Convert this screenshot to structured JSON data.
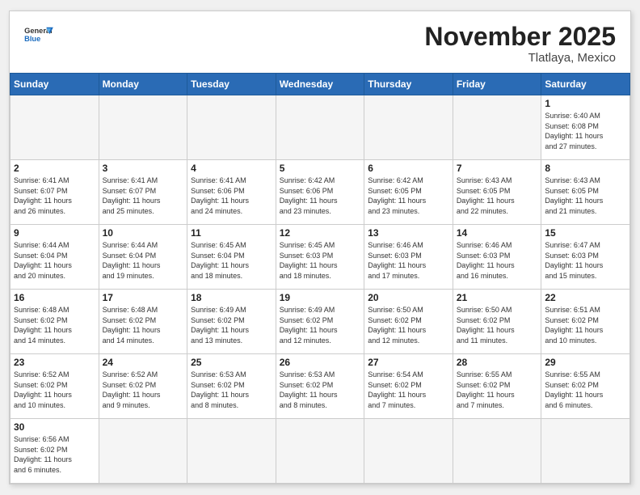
{
  "header": {
    "logo_general": "General",
    "logo_blue": "Blue",
    "month_title": "November 2025",
    "location": "Tlatlaya, Mexico"
  },
  "weekdays": [
    "Sunday",
    "Monday",
    "Tuesday",
    "Wednesday",
    "Thursday",
    "Friday",
    "Saturday"
  ],
  "weeks": [
    [
      {
        "day": "",
        "info": ""
      },
      {
        "day": "",
        "info": ""
      },
      {
        "day": "",
        "info": ""
      },
      {
        "day": "",
        "info": ""
      },
      {
        "day": "",
        "info": ""
      },
      {
        "day": "",
        "info": ""
      },
      {
        "day": "1",
        "info": "Sunrise: 6:40 AM\nSunset: 6:08 PM\nDaylight: 11 hours\nand 27 minutes."
      }
    ],
    [
      {
        "day": "2",
        "info": "Sunrise: 6:41 AM\nSunset: 6:07 PM\nDaylight: 11 hours\nand 26 minutes."
      },
      {
        "day": "3",
        "info": "Sunrise: 6:41 AM\nSunset: 6:07 PM\nDaylight: 11 hours\nand 25 minutes."
      },
      {
        "day": "4",
        "info": "Sunrise: 6:41 AM\nSunset: 6:06 PM\nDaylight: 11 hours\nand 24 minutes."
      },
      {
        "day": "5",
        "info": "Sunrise: 6:42 AM\nSunset: 6:06 PM\nDaylight: 11 hours\nand 23 minutes."
      },
      {
        "day": "6",
        "info": "Sunrise: 6:42 AM\nSunset: 6:05 PM\nDaylight: 11 hours\nand 23 minutes."
      },
      {
        "day": "7",
        "info": "Sunrise: 6:43 AM\nSunset: 6:05 PM\nDaylight: 11 hours\nand 22 minutes."
      },
      {
        "day": "8",
        "info": "Sunrise: 6:43 AM\nSunset: 6:05 PM\nDaylight: 11 hours\nand 21 minutes."
      }
    ],
    [
      {
        "day": "9",
        "info": "Sunrise: 6:44 AM\nSunset: 6:04 PM\nDaylight: 11 hours\nand 20 minutes."
      },
      {
        "day": "10",
        "info": "Sunrise: 6:44 AM\nSunset: 6:04 PM\nDaylight: 11 hours\nand 19 minutes."
      },
      {
        "day": "11",
        "info": "Sunrise: 6:45 AM\nSunset: 6:04 PM\nDaylight: 11 hours\nand 18 minutes."
      },
      {
        "day": "12",
        "info": "Sunrise: 6:45 AM\nSunset: 6:03 PM\nDaylight: 11 hours\nand 18 minutes."
      },
      {
        "day": "13",
        "info": "Sunrise: 6:46 AM\nSunset: 6:03 PM\nDaylight: 11 hours\nand 17 minutes."
      },
      {
        "day": "14",
        "info": "Sunrise: 6:46 AM\nSunset: 6:03 PM\nDaylight: 11 hours\nand 16 minutes."
      },
      {
        "day": "15",
        "info": "Sunrise: 6:47 AM\nSunset: 6:03 PM\nDaylight: 11 hours\nand 15 minutes."
      }
    ],
    [
      {
        "day": "16",
        "info": "Sunrise: 6:48 AM\nSunset: 6:02 PM\nDaylight: 11 hours\nand 14 minutes."
      },
      {
        "day": "17",
        "info": "Sunrise: 6:48 AM\nSunset: 6:02 PM\nDaylight: 11 hours\nand 14 minutes."
      },
      {
        "day": "18",
        "info": "Sunrise: 6:49 AM\nSunset: 6:02 PM\nDaylight: 11 hours\nand 13 minutes."
      },
      {
        "day": "19",
        "info": "Sunrise: 6:49 AM\nSunset: 6:02 PM\nDaylight: 11 hours\nand 12 minutes."
      },
      {
        "day": "20",
        "info": "Sunrise: 6:50 AM\nSunset: 6:02 PM\nDaylight: 11 hours\nand 12 minutes."
      },
      {
        "day": "21",
        "info": "Sunrise: 6:50 AM\nSunset: 6:02 PM\nDaylight: 11 hours\nand 11 minutes."
      },
      {
        "day": "22",
        "info": "Sunrise: 6:51 AM\nSunset: 6:02 PM\nDaylight: 11 hours\nand 10 minutes."
      }
    ],
    [
      {
        "day": "23",
        "info": "Sunrise: 6:52 AM\nSunset: 6:02 PM\nDaylight: 11 hours\nand 10 minutes."
      },
      {
        "day": "24",
        "info": "Sunrise: 6:52 AM\nSunset: 6:02 PM\nDaylight: 11 hours\nand 9 minutes."
      },
      {
        "day": "25",
        "info": "Sunrise: 6:53 AM\nSunset: 6:02 PM\nDaylight: 11 hours\nand 8 minutes."
      },
      {
        "day": "26",
        "info": "Sunrise: 6:53 AM\nSunset: 6:02 PM\nDaylight: 11 hours\nand 8 minutes."
      },
      {
        "day": "27",
        "info": "Sunrise: 6:54 AM\nSunset: 6:02 PM\nDaylight: 11 hours\nand 7 minutes."
      },
      {
        "day": "28",
        "info": "Sunrise: 6:55 AM\nSunset: 6:02 PM\nDaylight: 11 hours\nand 7 minutes."
      },
      {
        "day": "29",
        "info": "Sunrise: 6:55 AM\nSunset: 6:02 PM\nDaylight: 11 hours\nand 6 minutes."
      }
    ],
    [
      {
        "day": "30",
        "info": "Sunrise: 6:56 AM\nSunset: 6:02 PM\nDaylight: 11 hours\nand 6 minutes."
      },
      {
        "day": "",
        "info": ""
      },
      {
        "day": "",
        "info": ""
      },
      {
        "day": "",
        "info": ""
      },
      {
        "day": "",
        "info": ""
      },
      {
        "day": "",
        "info": ""
      },
      {
        "day": "",
        "info": ""
      }
    ]
  ]
}
